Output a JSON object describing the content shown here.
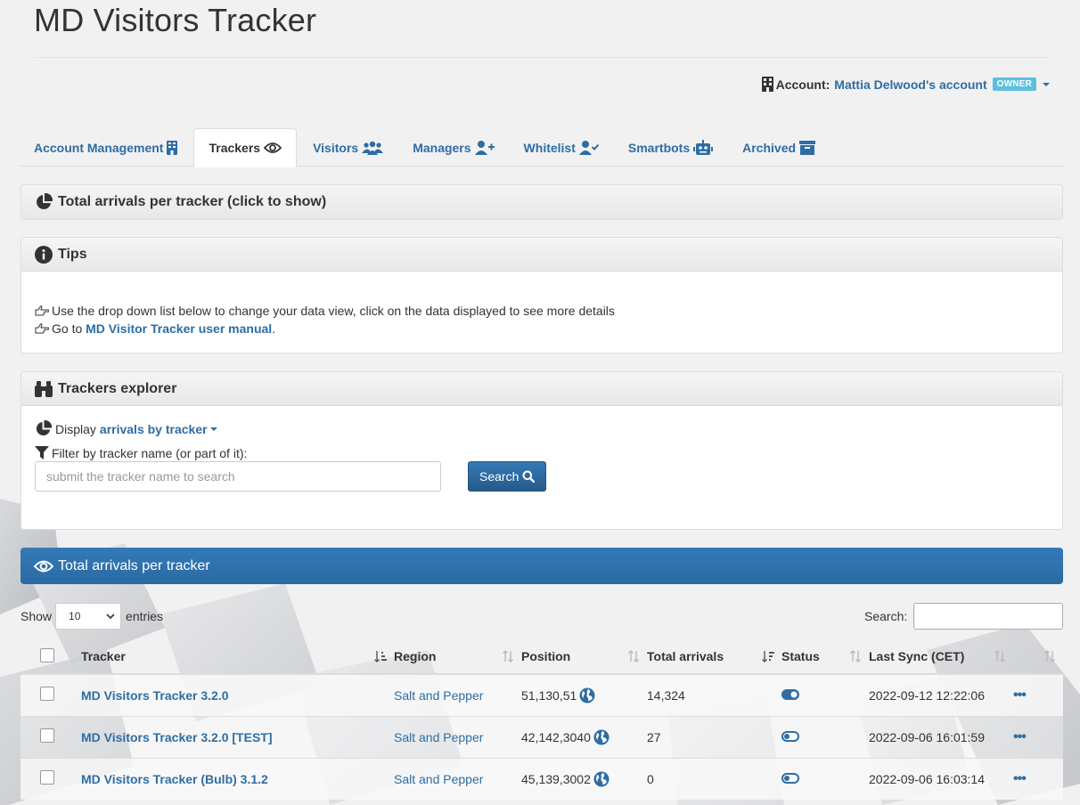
{
  "page": {
    "title": "MD Visitors Tracker"
  },
  "account": {
    "label": "Account:",
    "name": "Mattia Delwood's account",
    "role_badge": "OWNER"
  },
  "tabs": [
    {
      "label": "Account Management",
      "icon": "building-icon"
    },
    {
      "label": "Trackers",
      "icon": "eye-icon",
      "active": true
    },
    {
      "label": "Visitors",
      "icon": "users-icon"
    },
    {
      "label": "Managers",
      "icon": "user-plus-icon"
    },
    {
      "label": "Whitelist",
      "icon": "user-check-icon"
    },
    {
      "label": "Smartbots",
      "icon": "robot-icon"
    },
    {
      "label": "Archived",
      "icon": "archive-icon"
    }
  ],
  "arrivals_panel": {
    "title": "Total arrivals per tracker (click to show)"
  },
  "tips_panel": {
    "title": "Tips",
    "tip1": "Use the drop down list below to change your data view, click on the data displayed to see more details",
    "tip2_prefix": "Go to",
    "tip2_link": "MD Visitor Tracker user manual",
    "tip2_suffix": "."
  },
  "explorer_panel": {
    "title": "Trackers explorer",
    "display_label": "Display",
    "display_value": "arrivals by tracker",
    "filter_label": "Filter by tracker name (or part of it):",
    "search_placeholder": "submit the tracker name to search",
    "search_button": "Search"
  },
  "results_bar": {
    "title": "Total arrivals per tracker"
  },
  "table_controls": {
    "show_label": "Show",
    "show_value": "10",
    "entries_label": "entries",
    "search_label": "Search:"
  },
  "table": {
    "headers": {
      "tracker": "Tracker",
      "region": "Region",
      "position": "Position",
      "total_arrivals": "Total arrivals",
      "status": "Status",
      "last_sync": "Last Sync (CET)"
    },
    "rows": [
      {
        "tracker": "MD Visitors Tracker 3.2.0",
        "region": "Salt and Pepper",
        "position": "51,130,51",
        "arrivals": "14,324",
        "status": "on",
        "last_sync": "2022-09-12 12:22:06",
        "actions": "•••"
      },
      {
        "tracker": "MD Visitors Tracker 3.2.0 [TEST]",
        "region": "Salt and Pepper",
        "position": "42,142,3040",
        "arrivals": "27",
        "status": "off",
        "last_sync": "2022-09-06 16:01:59",
        "actions": "•••"
      },
      {
        "tracker": "MD Visitors Tracker (Bulb) 3.1.2",
        "region": "Salt and Pepper",
        "position": "45,139,3002",
        "arrivals": "0",
        "status": "off",
        "last_sync": "2022-09-06 16:03:14",
        "actions": "•••"
      }
    ]
  },
  "colors": {
    "link": "#2e6da4",
    "primary": "#337ab7",
    "badge": "#5bc0de"
  }
}
